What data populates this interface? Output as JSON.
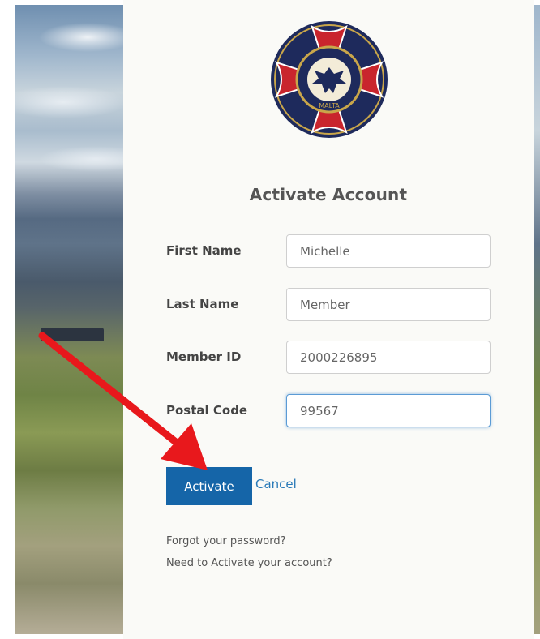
{
  "form": {
    "title": "Activate Account",
    "fields": [
      {
        "label": "First Name",
        "value": "Michelle"
      },
      {
        "label": "Last Name",
        "value": "Member"
      },
      {
        "label": "Member ID",
        "value": "2000226895"
      },
      {
        "label": "Postal Code",
        "value": "99567"
      }
    ],
    "activate_label": "Activate",
    "cancel_label": "Cancel"
  },
  "links": {
    "forgot_password": "Forgot your password?",
    "activate_account": "Need to Activate your account?"
  },
  "logo": {
    "icon": "organization-seal-icon",
    "text": "MALTA"
  },
  "annotation": {
    "icon": "red-arrow-icon",
    "color": "#e8181c"
  },
  "colors": {
    "primary": "#1565a8",
    "link": "#2a7ab8",
    "seal_red": "#c9252d",
    "seal_navy": "#1e2a5c",
    "seal_gold": "#c9a64a"
  }
}
